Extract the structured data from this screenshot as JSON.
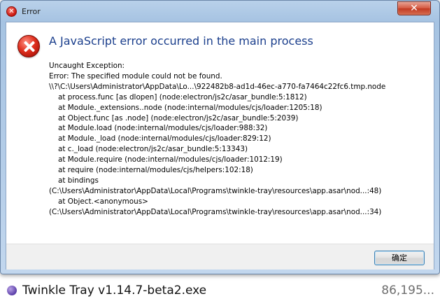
{
  "dialog": {
    "title": "Error",
    "close_glyph": "✕",
    "headline": "A JavaScript error occurred in the main process",
    "message_lines": [
      {
        "text": "Uncaught Exception:",
        "indent": false
      },
      {
        "text": "Error: The specified module could not be found.",
        "indent": false
      },
      {
        "text": "\\\\?\\C:\\Users\\Administrator\\AppData\\Lo...\\922482b8-ad1d-46ec-a770-fa7464c22fc6.tmp.node",
        "indent": false
      },
      {
        "text": "at process.func [as dlopen] (node:electron/js2c/asar_bundle:5:1812)",
        "indent": true
      },
      {
        "text": "at Module._extensions..node (node:internal/modules/cjs/loader:1205:18)",
        "indent": true
      },
      {
        "text": "at Object.func [as .node] (node:electron/js2c/asar_bundle:5:2039)",
        "indent": true
      },
      {
        "text": "at Module.load (node:internal/modules/cjs/loader:988:32)",
        "indent": true
      },
      {
        "text": "at Module._load (node:internal/modules/cjs/loader:829:12)",
        "indent": true
      },
      {
        "text": "at c._load (node:electron/js2c/asar_bundle:5:13343)",
        "indent": true
      },
      {
        "text": "at Module.require (node:internal/modules/cjs/loader:1012:19)",
        "indent": true
      },
      {
        "text": "at require (node:internal/modules/cjs/helpers:102:18)",
        "indent": true
      },
      {
        "text": "at bindings",
        "indent": true
      },
      {
        "text": "(C:\\Users\\Administrator\\AppData\\Local\\Programs\\twinkle-tray\\resources\\app.asar\\nod...:48)",
        "indent": false
      },
      {
        "text": "at Object.<anonymous>",
        "indent": true
      },
      {
        "text": "(C:\\Users\\Administrator\\AppData\\Local\\Programs\\twinkle-tray\\resources\\app.asar\\nod...:34)",
        "indent": false
      }
    ],
    "ok_label": "确定"
  },
  "file_list": [
    {
      "name": "Twinkle Tray v1.14.7-beta2.exe",
      "size": "86,195..."
    }
  ],
  "colors": {
    "headline": "#1a3e8c",
    "close_button": "#c23a22",
    "error_icon": "#e0301f"
  }
}
